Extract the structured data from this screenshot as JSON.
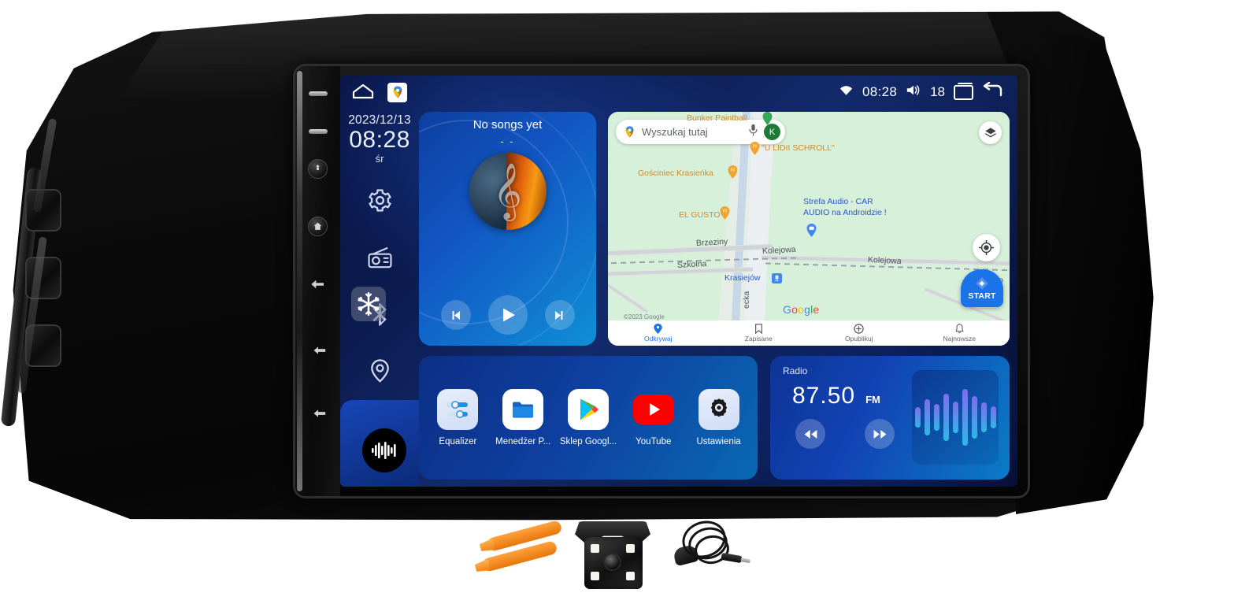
{
  "status_bar": {
    "home_icon": "home-outline-icon",
    "maps_shortcut_icon": "google-maps-icon",
    "wifi_icon": "wifi-icon",
    "clock": "08:28",
    "volume_icon": "volume-icon",
    "volume_level": "18",
    "recents_icon": "recents-icon",
    "back_icon": "back-arrow-icon"
  },
  "rail": {
    "date": "2023/12/13",
    "time": "08:28",
    "weekday": "śr",
    "icons": [
      {
        "name": "settings-gear-icon"
      },
      {
        "name": "radio-icon"
      },
      {
        "name": "bluetooth-icon"
      },
      {
        "name": "location-pin-icon"
      }
    ],
    "waveform_button_icon": "audio-waveform-icon",
    "watermark_icon": "snowflake-icon"
  },
  "media": {
    "title": "No songs yet",
    "subtitle": "- -",
    "album_art": "music-note-globe-art",
    "prev_icon": "skip-previous-icon",
    "play_icon": "play-icon",
    "next_icon": "skip-next-icon"
  },
  "map": {
    "search_placeholder": "Wyszukaj tutaj",
    "gmaps_icon": "google-maps-pin-icon",
    "mic_icon": "microphone-icon",
    "avatar_initial": "K",
    "layers_icon": "map-layers-icon",
    "mylocation_icon": "my-location-icon",
    "start_label": "START",
    "start_icon": "navigation-arrow-icon",
    "watermark": "Google",
    "copyright": "©2023 Google",
    "pois": [
      {
        "label": "Bunker Paintball",
        "type": "poi"
      },
      {
        "label": "\"U LIDII SCHROLL\"",
        "type": "poi"
      },
      {
        "label": "Gościniec Krasieńka",
        "type": "poi"
      },
      {
        "label": "EL GUSTO",
        "type": "poi"
      },
      {
        "label": "Strefa Audio - CAR",
        "type": "business"
      },
      {
        "label": "AUDIO na Androidzie !",
        "type": "business"
      },
      {
        "label": "Krasiejów",
        "type": "place"
      }
    ],
    "roads": [
      {
        "label": "Brzeziny"
      },
      {
        "label": "Szkolna"
      },
      {
        "label": "Kolejowa"
      },
      {
        "label": "Kolejowa"
      },
      {
        "label": "ecka"
      },
      {
        "label": "elo"
      }
    ],
    "bottom_nav": [
      {
        "label": "Odkrywaj",
        "icon": "pin-icon",
        "active": true
      },
      {
        "label": "Zapisane",
        "icon": "bookmark-icon",
        "active": false
      },
      {
        "label": "Opublikuj",
        "icon": "plus-circle-icon",
        "active": false
      },
      {
        "label": "Najnowsze",
        "icon": "bell-icon",
        "active": false
      }
    ]
  },
  "apps": [
    {
      "label": "Equalizer",
      "icon": "equalizer-icon"
    },
    {
      "label": "Menedżer P...",
      "icon": "file-manager-icon"
    },
    {
      "label": "Sklep Googl...",
      "icon": "google-play-icon"
    },
    {
      "label": "YouTube",
      "icon": "youtube-icon"
    },
    {
      "label": "Ustawienia",
      "icon": "settings-gear-icon"
    }
  ],
  "radio": {
    "title": "Radio",
    "frequency": "87.50",
    "band": "FM",
    "seek_back_icon": "rewind-icon",
    "seek_forward_icon": "fast-forward-icon",
    "visualizer_icon": "audio-bars-icon",
    "bars": [
      26,
      46,
      34,
      60,
      40,
      72,
      54,
      38,
      28
    ]
  },
  "hardware_buttons": [
    {
      "name": "dash-button-1",
      "icon": "dash-icon"
    },
    {
      "name": "dash-button-2",
      "icon": "dash-icon"
    },
    {
      "name": "power-button",
      "icon": "power-icon"
    },
    {
      "name": "home-button",
      "icon": "home-icon"
    },
    {
      "name": "back-button",
      "icon": "back-icon"
    },
    {
      "name": "left-arrow-button",
      "icon": "arrow-left-icon"
    },
    {
      "name": "right-arrow-button",
      "icon": "arrow-right-icon"
    }
  ],
  "accessories": [
    {
      "name": "pry-tools",
      "label": ""
    },
    {
      "name": "backup-camera",
      "label": ""
    },
    {
      "name": "microphone",
      "label": ""
    }
  ],
  "colors": {
    "screen_blue": "#0b1a4d",
    "accent_blue": "#1a73e8",
    "map_green": "#d7f0d9",
    "youtube_red": "#ff0000"
  }
}
